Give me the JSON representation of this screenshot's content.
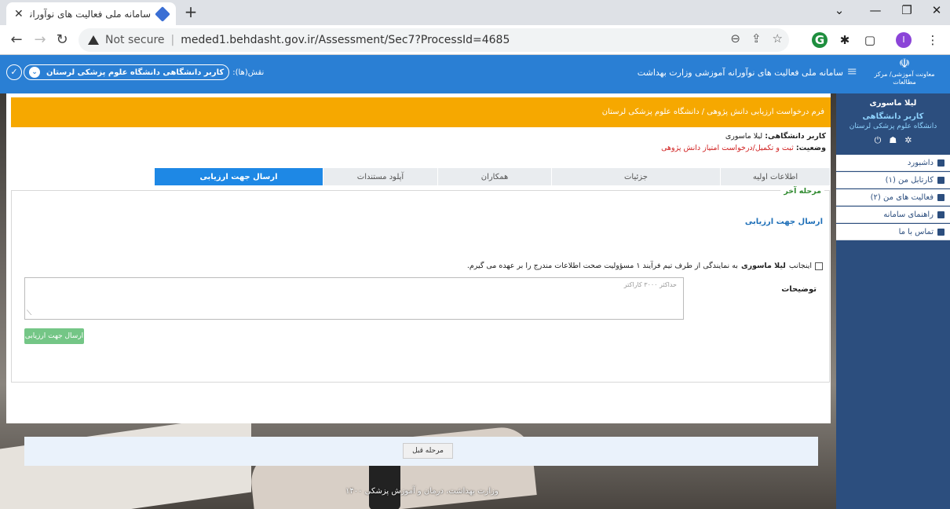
{
  "browser": {
    "tab_title": "سامانه ملی فعالیت های نوآورانه آم",
    "new_tab": "+",
    "not_secure": "Not secure",
    "url": "meded1.behdasht.gov.ir/Assessment/Sec7?ProcessId=4685",
    "profile_initial": "I"
  },
  "header": {
    "title": "سامانه ملی فعالیت های نوآورانه آموزشی وزارت بهداشت",
    "logo_text": "معاونت آموزشی/ مرکز مطالعات",
    "roles_label": "نقش(ها):",
    "role_value": "کاربر دانشگاهی دانشگاه علوم پزشکی لرستان"
  },
  "sidebar": {
    "user_name": "لیلا ماسوری",
    "user_role": "کاربر دانشگاهی",
    "user_org": "دانشگاه علوم پزشکی لرستان",
    "items": [
      {
        "label": "داشبورد",
        "icon": "dashboard-icon"
      },
      {
        "label": "کارتابل من (۱)",
        "icon": "inbox-icon"
      },
      {
        "label": "فعالیت های من (۲)",
        "icon": "activities-icon"
      },
      {
        "label": "راهنمای سامانه",
        "icon": "book-icon"
      },
      {
        "label": "تماس با ما",
        "icon": "phone-icon"
      }
    ]
  },
  "form": {
    "header": "فرم درخواست ارزیابی دانش پژوهی / دانشگاه علوم پزشکی لرستان",
    "user_label": "کاربر دانشگاهی:",
    "user_value": "لیلا ماسوری",
    "status_label": "وضعیت:",
    "status_value": "ثبت و تکمیل/درخواست امتیاز دانش پژوهی",
    "tabs": [
      {
        "label": "اطلاعات اولیه",
        "active": false
      },
      {
        "label": "جزئیات",
        "active": false
      },
      {
        "label": "همکاران",
        "active": false
      },
      {
        "label": "آپلود مستندات",
        "active": false
      },
      {
        "label": "ارسال جهت ارزیابی",
        "active": true
      }
    ],
    "step_legend": "مرحله آخر",
    "submit_title": "ارسال جهت ارزیابی",
    "declaration_pre": "اینجانب",
    "declaration_name": "لیلا ماسوری",
    "declaration_post": "به نمایندگی از طرف تیم فرآیند ۱ مسؤولیت صحت اطلاعات مندرج را بر عهده می گیرم.",
    "description_label": "توضیحات",
    "description_placeholder": "حداکثر ۳۰۰۰ کاراکتر",
    "send_button": "ارسال جهت ارزیابی",
    "prev_button": "مرحله قبل"
  },
  "footer": {
    "text": "وزارت بهداشت، درمان و آموزش پزشکی ۱۴۰۰"
  },
  "colors": {
    "header_blue": "#2a7fd4",
    "sidebar": "#2c4e7e",
    "form_header": "#f6a800",
    "active_tab": "#1e88e5",
    "send_button": "#74c686",
    "status_red": "#d02020"
  }
}
